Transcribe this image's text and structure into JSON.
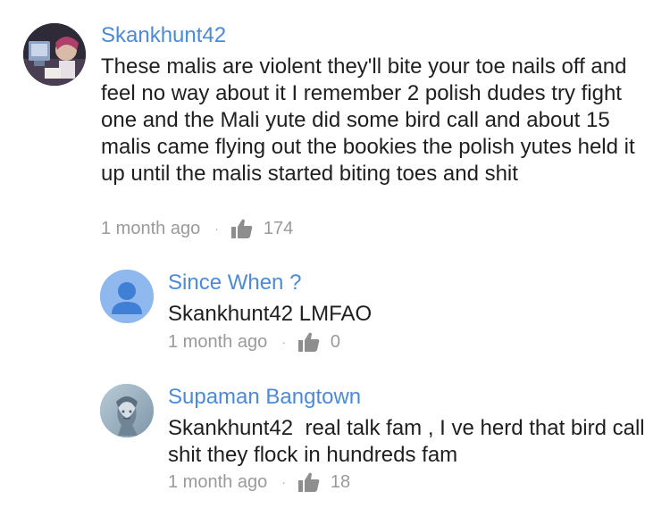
{
  "comments": [
    {
      "author": "Skankhunt42",
      "text": "These malis are violent they'll bite your toe nails off and feel no way about it I remember 2 polish dudes try fight one and the Mali yute did some bird call and about 15 malis came flying out the bookies the polish yutes held it up until the malis started biting toes and shit",
      "time": "1 month ago",
      "separator": "·",
      "likes": "174",
      "avatar_icon": "profile-photo-avatar"
    },
    {
      "author": "Since When ?",
      "text": "Skankhunt42 LMFAO",
      "time": "1 month ago",
      "separator": "·",
      "likes": "0",
      "avatar_icon": "default-user-avatar"
    },
    {
      "author": "Supaman Bangtown",
      "text": "Skankhunt42  real talk fam , I ve herd that bird call shit they flock in hundreds fam",
      "time": "1 month ago",
      "separator": "·",
      "likes": "18",
      "avatar_icon": "queen-banknote-avatar"
    }
  ],
  "colors": {
    "author": "#4c8ad8",
    "meta": "#9a9a9a",
    "text": "#1f1f1f",
    "default_avatar": "#8fb8ef"
  },
  "icons": {
    "like": "thumbs-up-icon"
  }
}
